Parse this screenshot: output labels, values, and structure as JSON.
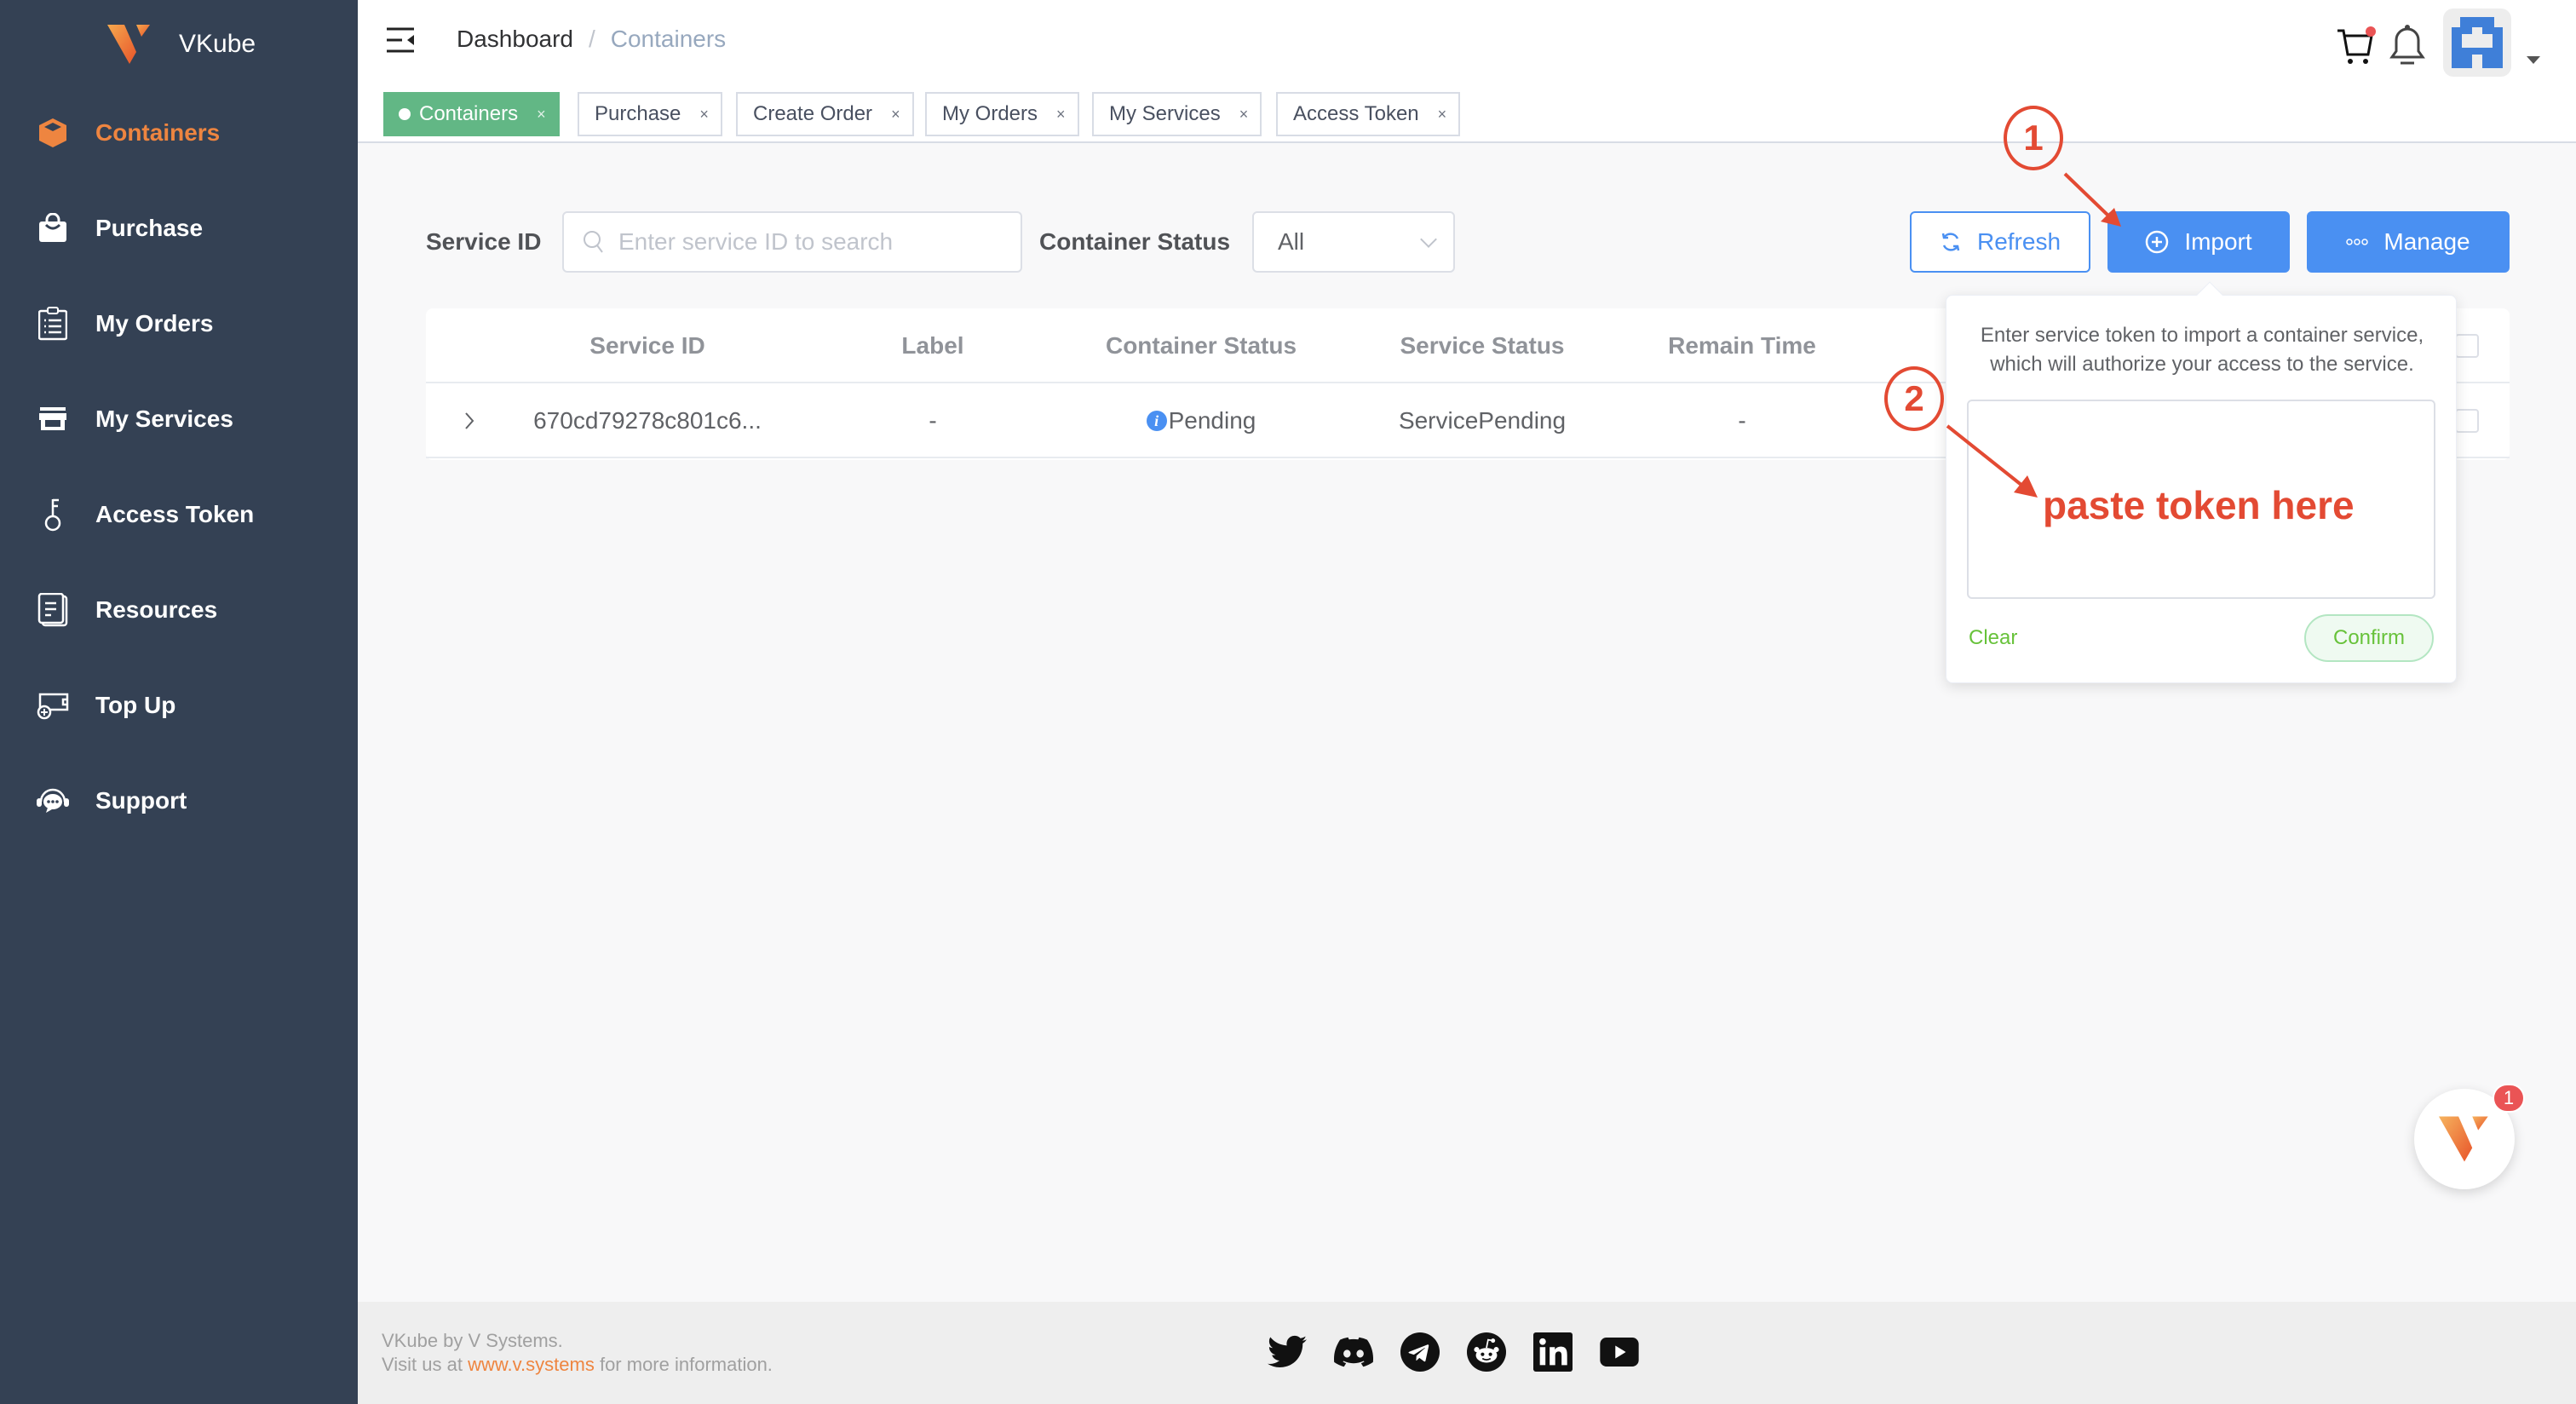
{
  "app": {
    "name": "VKube"
  },
  "sidebar": {
    "items": [
      {
        "label": "Containers",
        "icon": "cube-icon",
        "active": true
      },
      {
        "label": "Purchase",
        "icon": "shopping-bag-icon"
      },
      {
        "label": "My Orders",
        "icon": "clipboard-list-icon"
      },
      {
        "label": "My Services",
        "icon": "storefront-icon"
      },
      {
        "label": "Access Token",
        "icon": "key-icon"
      },
      {
        "label": "Resources",
        "icon": "documents-icon"
      },
      {
        "label": "Top Up",
        "icon": "wallet-plus-icon"
      },
      {
        "label": "Support",
        "icon": "headset-chat-icon"
      }
    ]
  },
  "header": {
    "breadcrumb": {
      "root": "Dashboard",
      "separator": "/",
      "current": "Containers"
    },
    "cart_has_badge": true
  },
  "tags": [
    {
      "label": "Containers",
      "active": true,
      "close": "×"
    },
    {
      "label": "Purchase",
      "close": "×"
    },
    {
      "label": "Create Order",
      "close": "×"
    },
    {
      "label": "My Orders",
      "close": "×"
    },
    {
      "label": "My Services",
      "close": "×"
    },
    {
      "label": "Access Token",
      "close": "×"
    }
  ],
  "filters": {
    "service_id_label": "Service ID",
    "service_id_placeholder": "Enter service ID to search",
    "service_id_value": "",
    "status_label": "Container Status",
    "status_value": "All"
  },
  "actions": {
    "refresh": "Refresh",
    "import": "Import",
    "manage": "Manage"
  },
  "table": {
    "columns": [
      "Service ID",
      "Label",
      "Container Status",
      "Service Status",
      "Remain Time"
    ],
    "rows": [
      {
        "service_id": "670cd79278c801c6...",
        "label": "-",
        "container_status": "Pending",
        "service_status": "ServicePending",
        "remain_time": "-"
      }
    ]
  },
  "import_popover": {
    "description": "Enter service token to import a container service, which will authorize your access to the service.",
    "token_value": "",
    "clear": "Clear",
    "confirm": "Confirm"
  },
  "annotations": {
    "step1": "1",
    "step2": "2",
    "hint": "paste token here",
    "color": "#e34a33"
  },
  "footer": {
    "line1": "VKube by V Systems.",
    "line2_prefix": "Visit us at",
    "link": "www.v.systems",
    "line2_suffix": "for more information.",
    "socials": [
      "twitter-icon",
      "discord-icon",
      "telegram-icon",
      "reddit-icon",
      "linkedin-icon",
      "youtube-icon"
    ]
  },
  "chat": {
    "badge": "1"
  },
  "colors": {
    "sidebar": "#344154",
    "accent": "#ee8540",
    "primary": "#4a90f2",
    "active_tag": "#62b785",
    "success": "#67c23a"
  }
}
